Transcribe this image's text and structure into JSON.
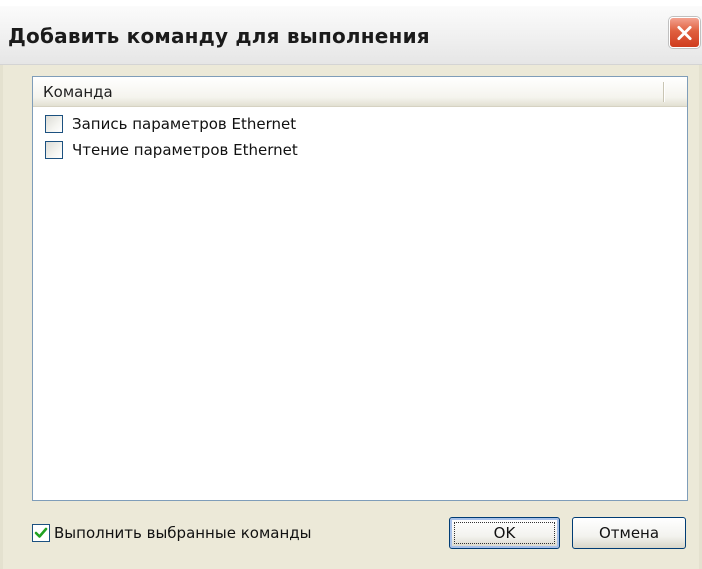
{
  "window": {
    "title": "Добавить команду для выполнения",
    "close_icon": "close-icon"
  },
  "list": {
    "column_header": "Команда",
    "items": [
      {
        "label": "Запись параметров Ethernet",
        "checked": false
      },
      {
        "label": "Чтение параметров Ethernet",
        "checked": false
      }
    ]
  },
  "footer": {
    "execute_selected_label": "Выполнить выбранные команды",
    "execute_selected_checked": true,
    "ok_label": "OK",
    "cancel_label": "Отмена"
  },
  "colors": {
    "close_button": "#d9533a",
    "window_background": "#ece9d8",
    "check_mark": "#21a121",
    "border_accent": "#7f9db9"
  }
}
